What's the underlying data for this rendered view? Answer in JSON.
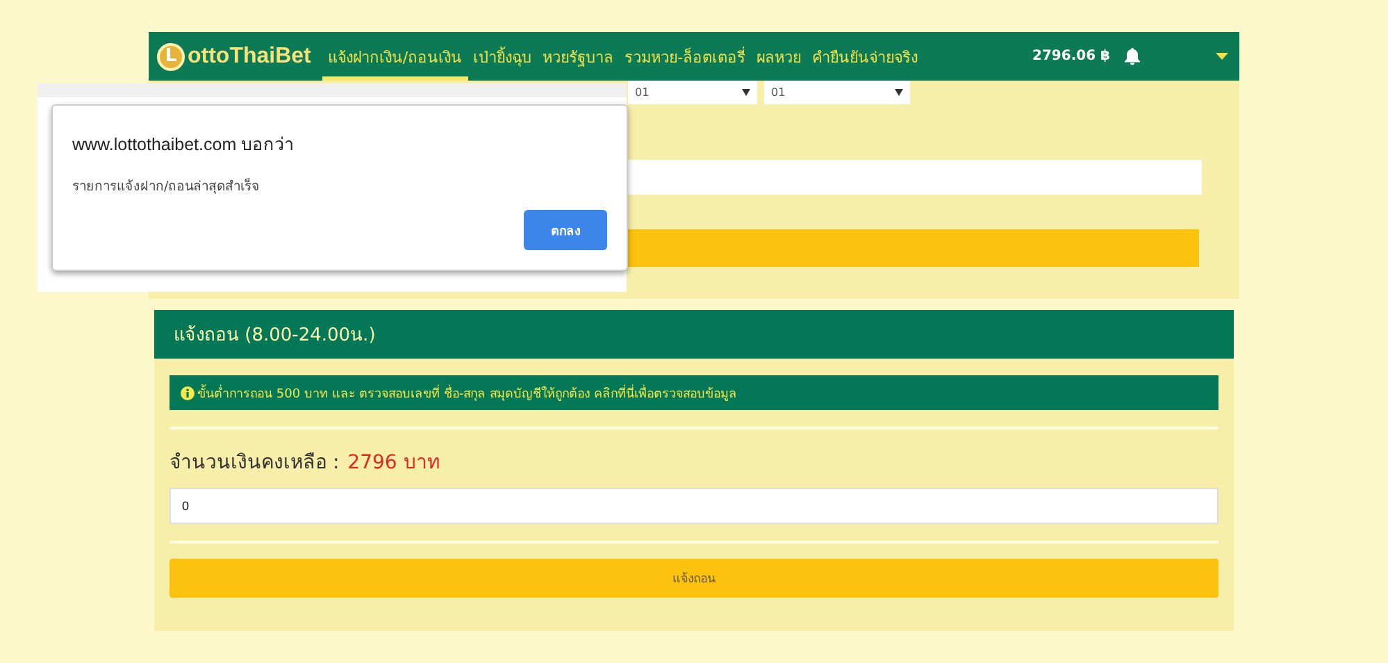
{
  "navbar": {
    "logo_letter": "L",
    "logo_text": "ottoThaiBet",
    "items": [
      {
        "label": "แจ้งฝากเงิน/ถอนเงิน",
        "selected": true
      },
      {
        "label": "เป่ายิ้งฉุบ",
        "selected": false
      },
      {
        "label": "หวยรัฐบาล",
        "selected": false
      },
      {
        "label": "รวมหวย-ล็อตเตอรี่",
        "selected": false
      },
      {
        "label": "ผลหวย",
        "selected": false
      },
      {
        "label": "คำยืนยันจ่ายจริง",
        "selected": false
      }
    ],
    "balance": "2796.06 ฿"
  },
  "deposit_form": {
    "selects": [
      "01",
      "01"
    ]
  },
  "dialog": {
    "title": "www.lottothaibet.com บอกว่า",
    "message": "รายการแจ้งฝาก/ถอนล่าสุดสำเร็จ",
    "button": "ตกลง"
  },
  "withdraw": {
    "title": "แจ้งถอน (8.00-24.00น.)",
    "notice": "ขั้นต่ำการถอน 500 บาท และ ตรวจสอบเลขที่ ชื่อ-สกุล สมุดบัญชีให้ถูกต้อง คลิกที่นี่เพื่อตรวจสอบข้อมูล",
    "balance_label": "จำนวนเงินคงเหลือ :",
    "balance_value": "2796 บาท",
    "amount": "0",
    "submit": "แจ้งถอน"
  }
}
